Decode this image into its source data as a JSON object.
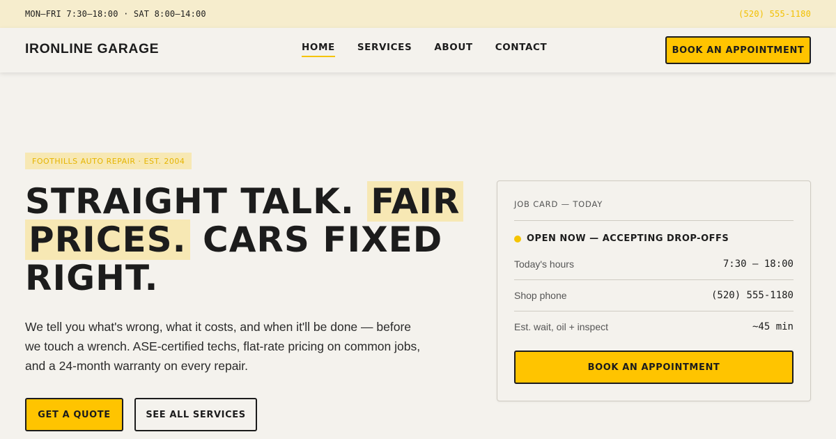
{
  "topbar": {
    "hours": "MON–FRI 7:30–18:00 · SAT 8:00–14:00",
    "phone": "(520) 555-1180"
  },
  "nav": {
    "logo": "IRONLINE GARAGE",
    "links": [
      {
        "label": "HOME",
        "active": true
      },
      {
        "label": "SERVICES",
        "active": false
      },
      {
        "label": "ABOUT",
        "active": false
      },
      {
        "label": "CONTACT",
        "active": false
      }
    ],
    "cta": "BOOK AN APPOINTMENT"
  },
  "hero": {
    "eyebrow": "FOOTHILLS AUTO REPAIR · EST. 2004",
    "headline": {
      "part1": "STRAIGHT TALK.",
      "highlight1": "FAIR",
      "highlight2": "PRICES.",
      "part2": "CARS FIXED RIGHT."
    },
    "lede": "We tell you what's wrong, what it costs, and when it'll be done — before we touch a wrench. ASE-certified techs, flat-rate pricing on common jobs, and a 24-month warranty on every repair.",
    "primary_button": "GET A QUOTE",
    "secondary_button": "SEE ALL SERVICES"
  },
  "job_card": {
    "title": "JOB CARD — TODAY",
    "status": "OPEN NOW — ACCEPTING DROP-OFFS",
    "rows": [
      {
        "label": "Today's hours",
        "value": "7:30 – 18:00"
      },
      {
        "label": "Shop phone",
        "value": "(520) 555-1180"
      },
      {
        "label": "Est. wait, oil + inspect",
        "value": "~45 min"
      }
    ],
    "button": "BOOK AN APPOINTMENT"
  },
  "colors": {
    "accent": "#ffc400",
    "highlight": "#f7e8b4",
    "topbar_bg": "#f6edcd",
    "page_bg": "#f4f2ed",
    "text": "#1c1c1c"
  }
}
